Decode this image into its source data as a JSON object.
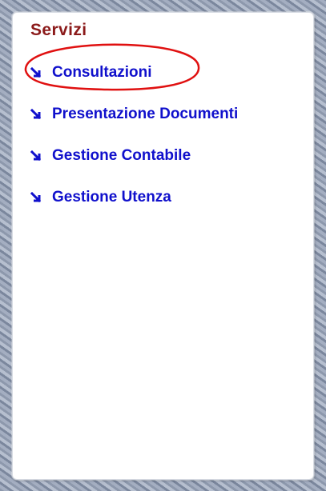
{
  "panel": {
    "title": "Servizi"
  },
  "menu": {
    "items": [
      {
        "label": "Consultazioni",
        "icon": "arrow-down-right-icon"
      },
      {
        "label": "Presentazione Documenti",
        "icon": "arrow-down-right-icon"
      },
      {
        "label": "Gestione Contabile",
        "icon": "arrow-down-right-icon"
      },
      {
        "label": "Gestione Utenza",
        "icon": "arrow-down-right-icon"
      }
    ]
  },
  "colors": {
    "title": "#8b1a1a",
    "link": "#1010cc",
    "highlight": "#e01010",
    "panel_background": "#ffffff",
    "backdrop": "#97a2b6"
  },
  "annotation": {
    "highlighted_item": "Consultazioni"
  }
}
